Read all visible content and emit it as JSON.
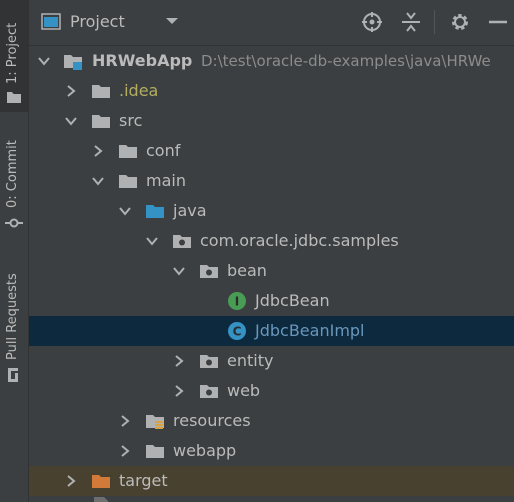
{
  "sidebar": {
    "tabs": [
      {
        "label": "1: Project",
        "active": true
      },
      {
        "label": "0: Commit",
        "active": false
      },
      {
        "label": "Pull Requests",
        "active": false
      }
    ]
  },
  "header": {
    "title": "Project",
    "buttons": [
      "locate-icon",
      "collapse-all-icon",
      "settings-icon",
      "hide-icon"
    ]
  },
  "tree": {
    "root": {
      "label": "HRWebApp",
      "path": "D:\\test\\oracle-db-examples\\java\\HRWe"
    },
    "items": {
      "idea": ".idea",
      "src": "src",
      "conf": "conf",
      "main": "main",
      "java": "java",
      "package": "com.oracle.jdbc.samples",
      "bean": "bean",
      "jdbcbean": "JdbcBean",
      "jdbcbeanimpl": "JdbcBeanImpl",
      "entity": "entity",
      "web": "web",
      "resources": "resources",
      "webapp": "webapp",
      "target": "target"
    }
  },
  "colors": {
    "selection": "#0d293e",
    "excluded": "#49412f",
    "interface_badge": "#499c54",
    "class_badge": "#3592c4",
    "java_folder": "#3592c4",
    "target_folder": "#d17a3a"
  }
}
